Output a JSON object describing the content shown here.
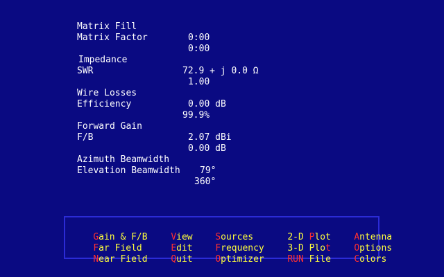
{
  "results": {
    "matrix_fill": {
      "label": "Matrix Fill",
      "value": "0:00"
    },
    "matrix_factor": {
      "label": "Matrix Factor",
      "value": "0:00"
    },
    "impedance": {
      "label": "Impedance",
      "value": "72.9 + j 0.0 Ω"
    },
    "swr": {
      "label": "SWR",
      "value": "1.00"
    },
    "wire_losses": {
      "label": "Wire Losses",
      "value": "0.00 dB"
    },
    "efficiency": {
      "label": "Efficiency",
      "value": "99.9%"
    },
    "forward_gain": {
      "label": "Forward Gain",
      "value": "2.07 dBi"
    },
    "fb": {
      "label": "F/B",
      "value": "0.00 dB"
    },
    "azimuth_beamwidth": {
      "label": "Azimuth Beamwidth",
      "value": "79°"
    },
    "elevation_beamwidth": {
      "label": "Elevation Beamwidth",
      "value": "360°"
    }
  },
  "menu": {
    "col1": [
      {
        "hot": "G",
        "rest": "ain & F/B"
      },
      {
        "hot": "F",
        "rest": "ar Field"
      },
      {
        "hot": "N",
        "rest": "ear Field"
      }
    ],
    "col2": [
      {
        "hot": "V",
        "rest": "iew"
      },
      {
        "hot": "E",
        "rest": "dit"
      },
      {
        "hot": "Q",
        "rest": "uit"
      }
    ],
    "col3": [
      {
        "hot": "S",
        "rest": "ources"
      },
      {
        "hot": "F",
        "rest": "requency"
      },
      {
        "hot": "O",
        "rest": "ptimizer"
      }
    ],
    "col4": [
      {
        "pre": "2-D ",
        "hot": "P",
        "rest": "lot"
      },
      {
        "pre": "3-D Plo",
        "hot": "t",
        "rest": ""
      },
      {
        "pre": "",
        "hot": "RUN",
        "rest": " File"
      }
    ],
    "col5": [
      {
        "hot": "A",
        "rest": "ntenna"
      },
      {
        "hot": "O",
        "rest": "ptions"
      },
      {
        "hot": "C",
        "rest": "olors"
      }
    ]
  },
  "colors": {
    "background": "#0a0a82",
    "text": "#ffffff",
    "menu_text": "#ffff3c",
    "hotkey": "#ff3030",
    "menu_border": "#2b2bd6"
  }
}
